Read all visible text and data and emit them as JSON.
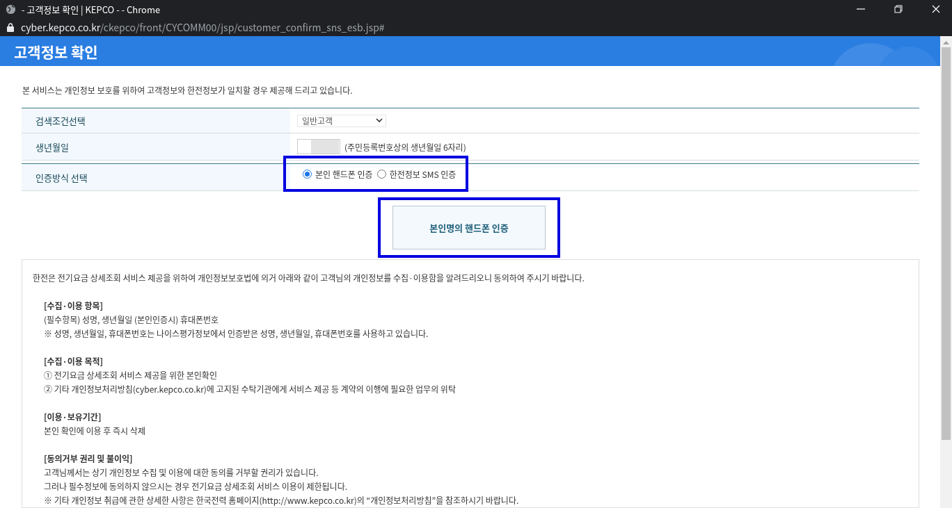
{
  "browser": {
    "title": "- 고객정보 확인 | KEPCO - - Chrome",
    "url_host": "cyber.kepco.co.kr",
    "url_path": "/ckepco/front/CYCOMM00/jsp/customer_confirm_sns_esb.jsp#"
  },
  "header_title": "고객정보 확인",
  "intro": "본 서비스는 개인정보 보호를 위하여 고객정보와 한전정보가 일치할 경우 제공해 드리고 있습니다.",
  "form_rows": [
    {
      "kind": "select",
      "label": "검색조건선택",
      "value": "일반고객"
    },
    {
      "kind": "input",
      "label": "생년월일",
      "hint": "(주민등록번호상의 생년월일 6자리)"
    },
    {
      "kind": "radio",
      "label": "인증방식 선택",
      "highlighted": true,
      "options": [
        {
          "label": "본인 핸드폰 인증",
          "selected": true
        },
        {
          "label": "한전정보 SMS 인증",
          "selected": false
        }
      ]
    }
  ],
  "action_button": {
    "label": "본인명의 핸드폰 인증",
    "highlighted": true
  },
  "consent": {
    "intro": "한전은 전기요금 상세조회 서비스 제공을 위하여 개인정보보호법에 의거 아래와 같이 고객님의 개인정보를 수집·이용함을 알려드리오니 동의하여 주시기 바랍니다.",
    "sections": [
      {
        "heading": "[수집·이용 항목]",
        "lines": [
          "(필수항목) 성명, 생년월일 (본인인증시) 휴대폰번호",
          "※ 성명, 생년월일, 휴대폰번호는 나이스평가정보에서 인증받은 성명, 생년월일, 휴대폰번호를 사용하고 있습니다."
        ]
      },
      {
        "heading": "[수집·이용 목적]",
        "lines": [
          "① 전기요금 상세조회 서비스 제공을 위한 본인확인",
          "② 기타 개인정보처리방침(cyber.kepco.co.kr)에 고지된 수탁기관에게 서비스 제공 등 계약의 이행에 필요한 업무의 위탁"
        ]
      },
      {
        "heading": "[이용·보유기간]",
        "lines": [
          "본인 확인에 이용 후 즉시 삭제"
        ]
      },
      {
        "heading": "[동의거부 권리 및 불이익]",
        "lines": [
          "고객님께서는 상기 개인정보 수집 및 이용에 대한 동의를 거부할 권리가 있습니다.",
          "그러나 필수정보에 동의하지 않으시는 경우 전기요금 상세조회 서비스 이용이 제한됩니다.",
          "※ 기타 개인정보 취급에 관한 상세한 사항은 한국전력 홈페이지(http://www.kepco.co.kr)의 “개인정보처리방침”을 참조하시기 바랍니다."
        ]
      }
    ]
  }
}
